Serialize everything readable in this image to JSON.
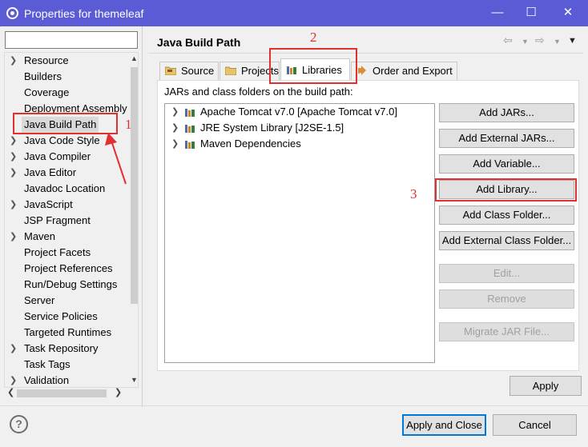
{
  "window": {
    "title": "Properties for themeleaf",
    "controls": {
      "minimize": "—",
      "maximize": "☐",
      "close": "✕"
    }
  },
  "filter": {
    "value": "",
    "placeholder": ""
  },
  "sidebar": {
    "items": [
      {
        "label": "Resource",
        "expandable": true
      },
      {
        "label": "Builders",
        "expandable": false
      },
      {
        "label": "Coverage",
        "expandable": false
      },
      {
        "label": "Deployment Assembly",
        "expandable": false
      },
      {
        "label": "Java Build Path",
        "expandable": false,
        "selected": true
      },
      {
        "label": "Java Code Style",
        "expandable": true
      },
      {
        "label": "Java Compiler",
        "expandable": true
      },
      {
        "label": "Java Editor",
        "expandable": true
      },
      {
        "label": "Javadoc Location",
        "expandable": false
      },
      {
        "label": "JavaScript",
        "expandable": true
      },
      {
        "label": "JSP Fragment",
        "expandable": false
      },
      {
        "label": "Maven",
        "expandable": true
      },
      {
        "label": "Project Facets",
        "expandable": false
      },
      {
        "label": "Project References",
        "expandable": false
      },
      {
        "label": "Run/Debug Settings",
        "expandable": false
      },
      {
        "label": "Server",
        "expandable": false
      },
      {
        "label": "Service Policies",
        "expandable": false
      },
      {
        "label": "Targeted Runtimes",
        "expandable": false
      },
      {
        "label": "Task Repository",
        "expandable": true
      },
      {
        "label": "Task Tags",
        "expandable": false
      },
      {
        "label": "Validation",
        "expandable": true
      }
    ]
  },
  "page": {
    "title": "Java Build Path",
    "tabs": [
      {
        "label": "Source"
      },
      {
        "label": "Projects"
      },
      {
        "label": "Libraries",
        "active": true
      },
      {
        "label": "Order and Export"
      }
    ],
    "panel_label": "JARs and class folders on the build path:",
    "libraries": [
      {
        "label": "Apache Tomcat v7.0 [Apache Tomcat v7.0]"
      },
      {
        "label": "JRE System Library [J2SE-1.5]"
      },
      {
        "label": "Maven Dependencies"
      }
    ],
    "buttons": {
      "add_jars": "Add JARs...",
      "add_external_jars": "Add External JARs...",
      "add_variable": "Add Variable...",
      "add_library": "Add Library...",
      "add_class_folder": "Add Class Folder...",
      "add_external_class_folder": "Add External Class Folder...",
      "edit": "Edit...",
      "remove": "Remove",
      "migrate_jar": "Migrate JAR File..."
    },
    "apply": "Apply"
  },
  "footer": {
    "help": "?",
    "apply_and_close": "Apply and Close",
    "cancel": "Cancel"
  },
  "annotations": {
    "step1": "1",
    "step2": "2",
    "step3": "3"
  },
  "colors": {
    "titlebar": "#5b5bd6",
    "annotation": "#e03030",
    "primary_border": "#0078d7"
  }
}
